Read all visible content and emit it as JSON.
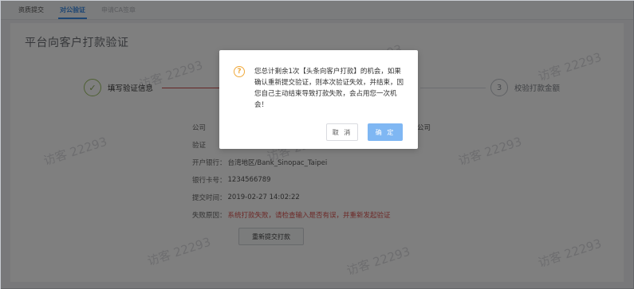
{
  "tabs": [
    {
      "label": "资质提交"
    },
    {
      "label": "对公验证"
    },
    {
      "label": "申请CA签章"
    }
  ],
  "page_title": "平台向客户打款验证",
  "steps": [
    {
      "label": "填写验证信息"
    },
    {
      "number": "3",
      "label": "校验打款金额"
    }
  ],
  "info": {
    "company_label": "公司",
    "company_value_tail": "公司",
    "verify_label": "验证",
    "bank_label": "开户银行：",
    "bank_value": "台湾地区/Bank_Sinopac_Taipei",
    "card_label": "银行卡号：",
    "card_value": "1234566789",
    "time_label": "提交时间：",
    "time_value": "2019-02-27 14:02:22",
    "reason_label": "失败原因：",
    "reason_value": "系统打款失败，请检查输入是否有误，并重新发起验证"
  },
  "resubmit_label": "重新提交打款",
  "watermark_text": "访客 22293",
  "modal": {
    "icon": "?",
    "message": "您总计剩余1次【头条向客户打款】的机会，如果确认重新提交验证，则本次验证失效，并结束，因您自己主动结束导致打款失败，会占用您一次机会！",
    "cancel_label": "取 消",
    "ok_label": "确 定"
  },
  "colors": {
    "accent": "#3d8de6",
    "error": "#d9534f",
    "warning": "#f0a93b",
    "success": "#9bbf63",
    "primary_button_disabled": "#7fb7f3"
  }
}
